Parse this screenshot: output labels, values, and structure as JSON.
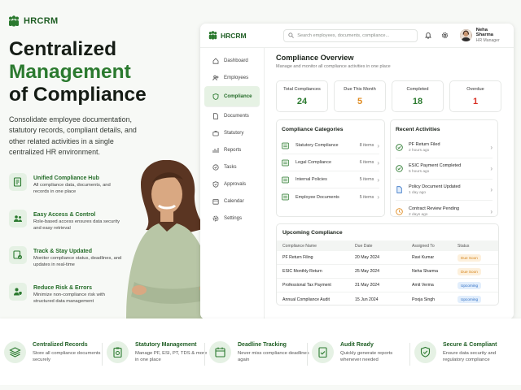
{
  "brand": {
    "name": "HRCRM"
  },
  "hero": {
    "line1": "Centralized",
    "line2": "Management",
    "line3": "of Compliance",
    "description": "Consolidate employee documentation, statutory records, compliant details, and other related activities in a single centralized HR environment."
  },
  "features": [
    {
      "title": "Unified Compliance Hub",
      "desc": "All compliance data, documents, and records in one place",
      "icon": "documents-icon"
    },
    {
      "title": "Easy Access & Control",
      "desc": "Role-based access ensures data security and easy retrieval",
      "icon": "users-icon"
    },
    {
      "title": "Track & Stay Updated",
      "desc": "Monitor compliance status, deadlines, and updates in real-time",
      "icon": "tracking-icon"
    },
    {
      "title": "Reduce Risk & Errors",
      "desc": "Minimize non-compliance risk with structured data management",
      "icon": "shield-user-icon"
    }
  ],
  "app": {
    "logo": "HRCRM",
    "search_placeholder": "Search employees, documents, compliance...",
    "user": {
      "name": "Neha Sharma",
      "role": "HR Manager"
    },
    "nav": [
      {
        "label": "Dashboard",
        "icon": "home-icon",
        "active": false
      },
      {
        "label": "Employees",
        "icon": "users-icon",
        "active": false
      },
      {
        "label": "Compliance",
        "icon": "shield-icon",
        "active": true
      },
      {
        "label": "Documents",
        "icon": "document-icon",
        "active": false
      },
      {
        "label": "Statutory",
        "icon": "briefcase-icon",
        "active": false
      },
      {
        "label": "Reports",
        "icon": "report-icon",
        "active": false
      },
      {
        "label": "Tasks",
        "icon": "check-circle-icon",
        "active": false
      },
      {
        "label": "Approvals",
        "icon": "approval-icon",
        "active": false
      },
      {
        "label": "Calendar",
        "icon": "calendar-icon",
        "active": false
      },
      {
        "label": "Settings",
        "icon": "gear-icon",
        "active": false
      }
    ],
    "overview": {
      "title": "Compliance Overview",
      "subtitle": "Manage and monitor all compliance activities in one place"
    },
    "stats": [
      {
        "label": "Total Compliances",
        "value": "24",
        "color": "#2b7a2f"
      },
      {
        "label": "Due This Month",
        "value": "5",
        "color": "#e08a1e"
      },
      {
        "label": "Completed",
        "value": "18",
        "color": "#2b7a2f"
      },
      {
        "label": "Overdue",
        "value": "1",
        "color": "#d93025"
      }
    ],
    "categories": {
      "title": "Compliance Categories",
      "items": [
        {
          "name": "Statutory Compliance",
          "count": "8 items"
        },
        {
          "name": "Legal Compliance",
          "count": "6 items"
        },
        {
          "name": "Internal Policies",
          "count": "5 items"
        },
        {
          "name": "Employee Documents",
          "count": "5 items"
        }
      ]
    },
    "activities": {
      "title": "Recent Activities",
      "items": [
        {
          "name": "PF Return Filed",
          "when": "2 hours ago",
          "color": "#2b7a2f"
        },
        {
          "name": "ESIC Payment Completed",
          "when": "5 hours ago",
          "color": "#2b7a2f"
        },
        {
          "name": "Policy Document Updated",
          "when": "1 day ago",
          "color": "#2f6fc4"
        },
        {
          "name": "Contract Review Pending",
          "when": "2 days ago",
          "color": "#e08a1e"
        }
      ]
    },
    "upcoming": {
      "title": "Upcoming Compliance",
      "headers": [
        "Compliance Name",
        "Due Date",
        "Assigned To",
        "Status"
      ],
      "rows": [
        {
          "name": "PF Return Filing",
          "date": "20 May 2024",
          "assignee": "Ravi Kumar",
          "status": "Due Soon",
          "kind": "due"
        },
        {
          "name": "ESIC Monthly Return",
          "date": "25 May 2024",
          "assignee": "Neha Sharma",
          "status": "Due Soon",
          "kind": "due"
        },
        {
          "name": "Professional Tax Payment",
          "date": "31 May 2024",
          "assignee": "Amit Verma",
          "status": "Upcoming",
          "kind": "up"
        },
        {
          "name": "Annual Compliance Audit",
          "date": "15 Jun 2024",
          "assignee": "Pooja Singh",
          "status": "Upcoming",
          "kind": "up"
        }
      ]
    }
  },
  "bottom": [
    {
      "title": "Centralized Records",
      "desc": "Store all compliance documents securely",
      "icon": "layers-icon"
    },
    {
      "title": "Statutory Management",
      "desc": "Manage PF, ESI, PT, TDS & more in one place",
      "icon": "clipboard-icon"
    },
    {
      "title": "Deadline Tracking",
      "desc": "Never miss compliance deadlines again",
      "icon": "calendar-icon"
    },
    {
      "title": "Audit Ready",
      "desc": "Quickly generate reports whenever needed",
      "icon": "audit-icon"
    },
    {
      "title": "Secure & Compliant",
      "desc": "Ensure data security and regulatory compliance",
      "icon": "shield-check-icon"
    }
  ],
  "colors": {
    "accent": "#2b7a2f",
    "dark_green": "#1f5e24",
    "soft_green": "#e5f1e4"
  }
}
